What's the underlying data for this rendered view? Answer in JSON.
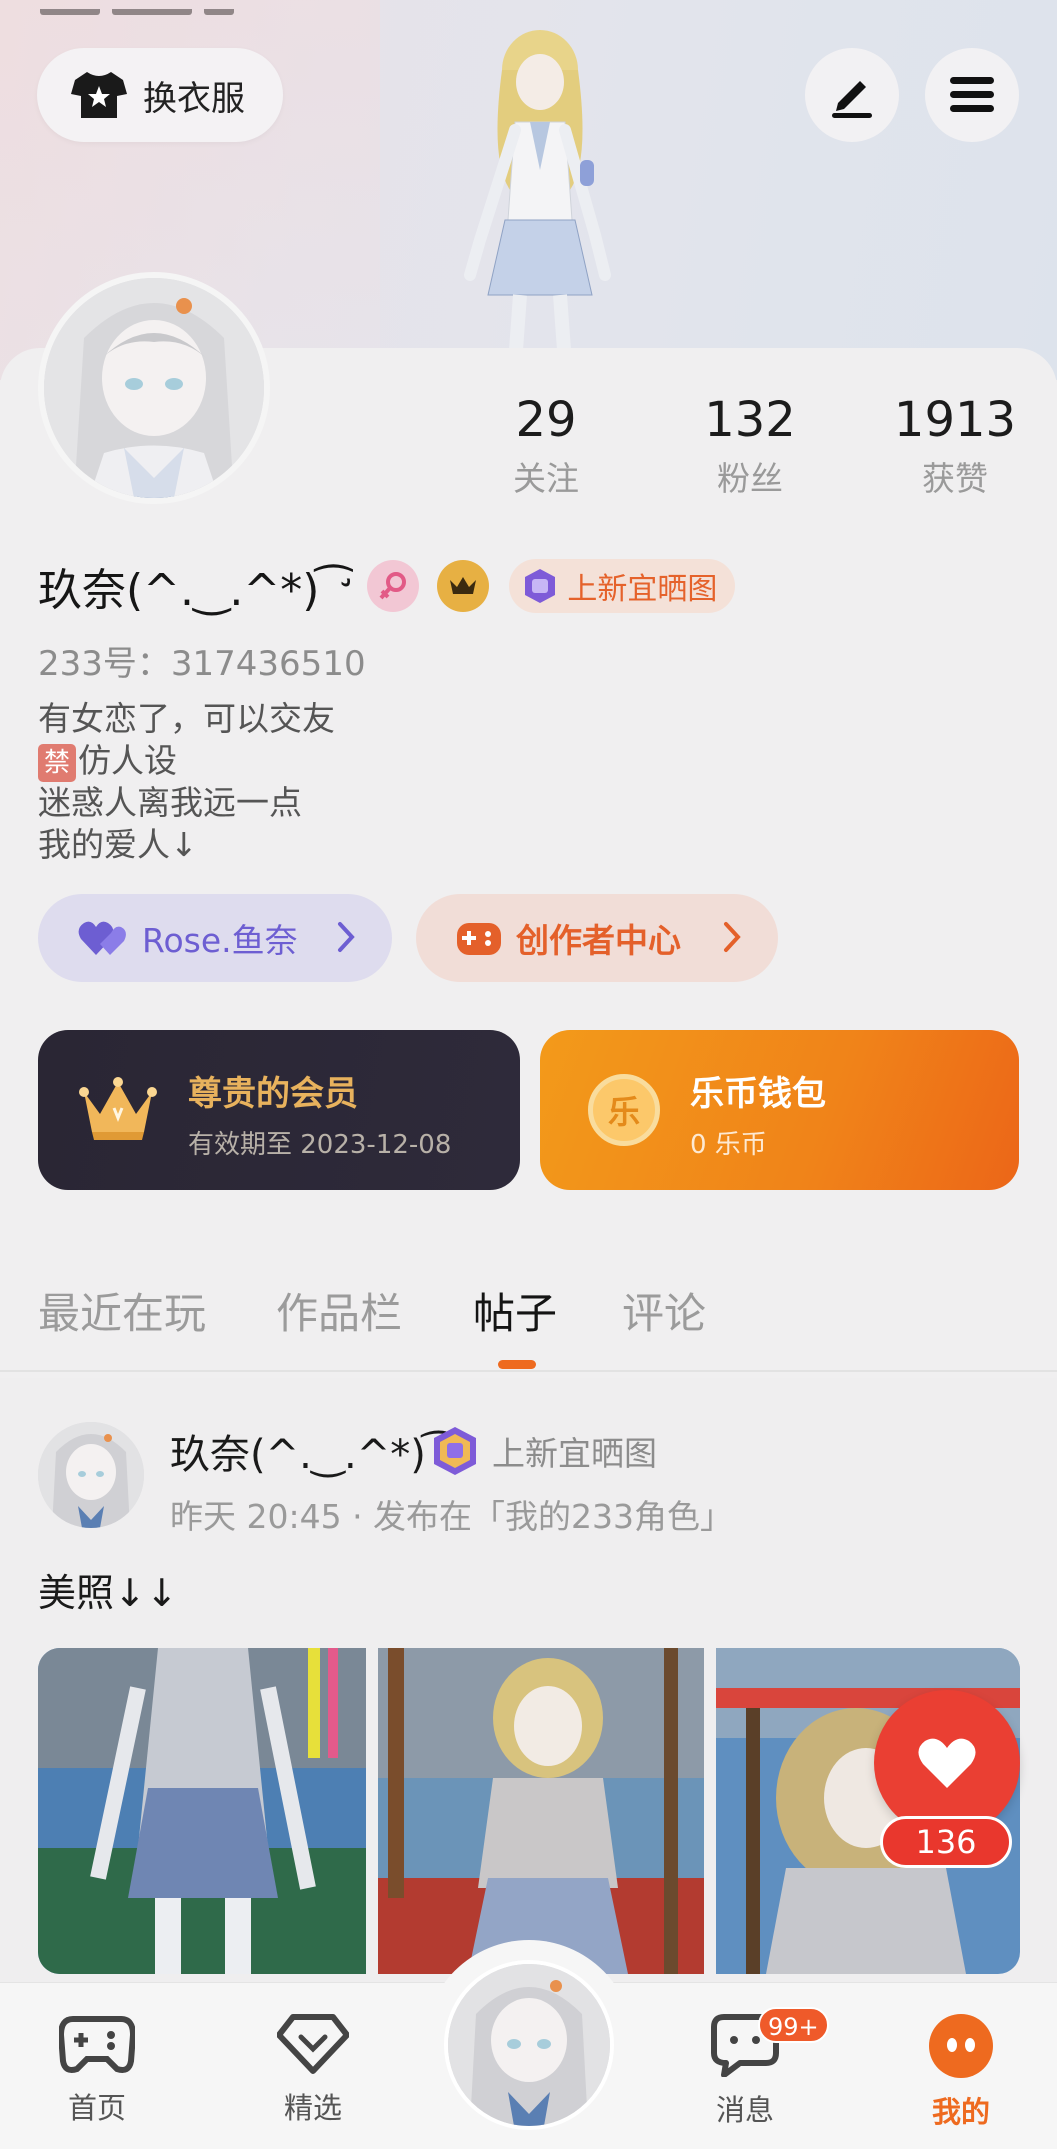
{
  "header": {
    "outfit_button_label": "换衣服",
    "edit_icon": "pencil-icon",
    "menu_icon": "menu-icon"
  },
  "profile": {
    "stats": [
      {
        "value": "29",
        "label": "关注"
      },
      {
        "value": "132",
        "label": "粉丝"
      },
      {
        "value": "1913",
        "label": "获赞"
      }
    ],
    "name": "玖奈(^.‿.^*) ͡ ̛",
    "title_badge": "上新宜晒图",
    "uid": "233号：317436510",
    "bio": [
      "有女恋了，可以交友",
      "仿人设",
      "迷惑人离我远一点",
      "我的爱人↓"
    ],
    "bio_tag": "禁",
    "rose_link": "Rose.鱼奈",
    "creator_center": "创作者中心",
    "vip": {
      "title": "尊贵的会员",
      "expiry": "有效期至 2023-12-08"
    },
    "wallet": {
      "title": "乐币钱包",
      "balance": "0 乐币",
      "coin_glyph": "乐"
    }
  },
  "tabs": [
    {
      "label": "最近在玩",
      "active": false
    },
    {
      "label": "作品栏",
      "active": false
    },
    {
      "label": "帖子",
      "active": true
    },
    {
      "label": "评论",
      "active": false
    }
  ],
  "post": {
    "author": "玖奈(^.‿.^*) ͡ ̛",
    "author_badge": "上新宜晒图",
    "meta": "昨天 20:45 · 发布在「我的233角色」",
    "text": "美照↓↓",
    "likes": "136"
  },
  "bottom_nav": [
    {
      "label": "首页",
      "icon": "gamepad-icon"
    },
    {
      "label": "精选",
      "icon": "heart-diamond-icon"
    },
    {
      "label": "消息",
      "icon": "chat-icon",
      "badge": "99+"
    },
    {
      "label": "我的",
      "icon": "profile-face-icon",
      "active": true
    }
  ],
  "colors": {
    "accent": "#ee6a1f",
    "rose": "#6d5ed2",
    "like": "#ea3f33"
  }
}
